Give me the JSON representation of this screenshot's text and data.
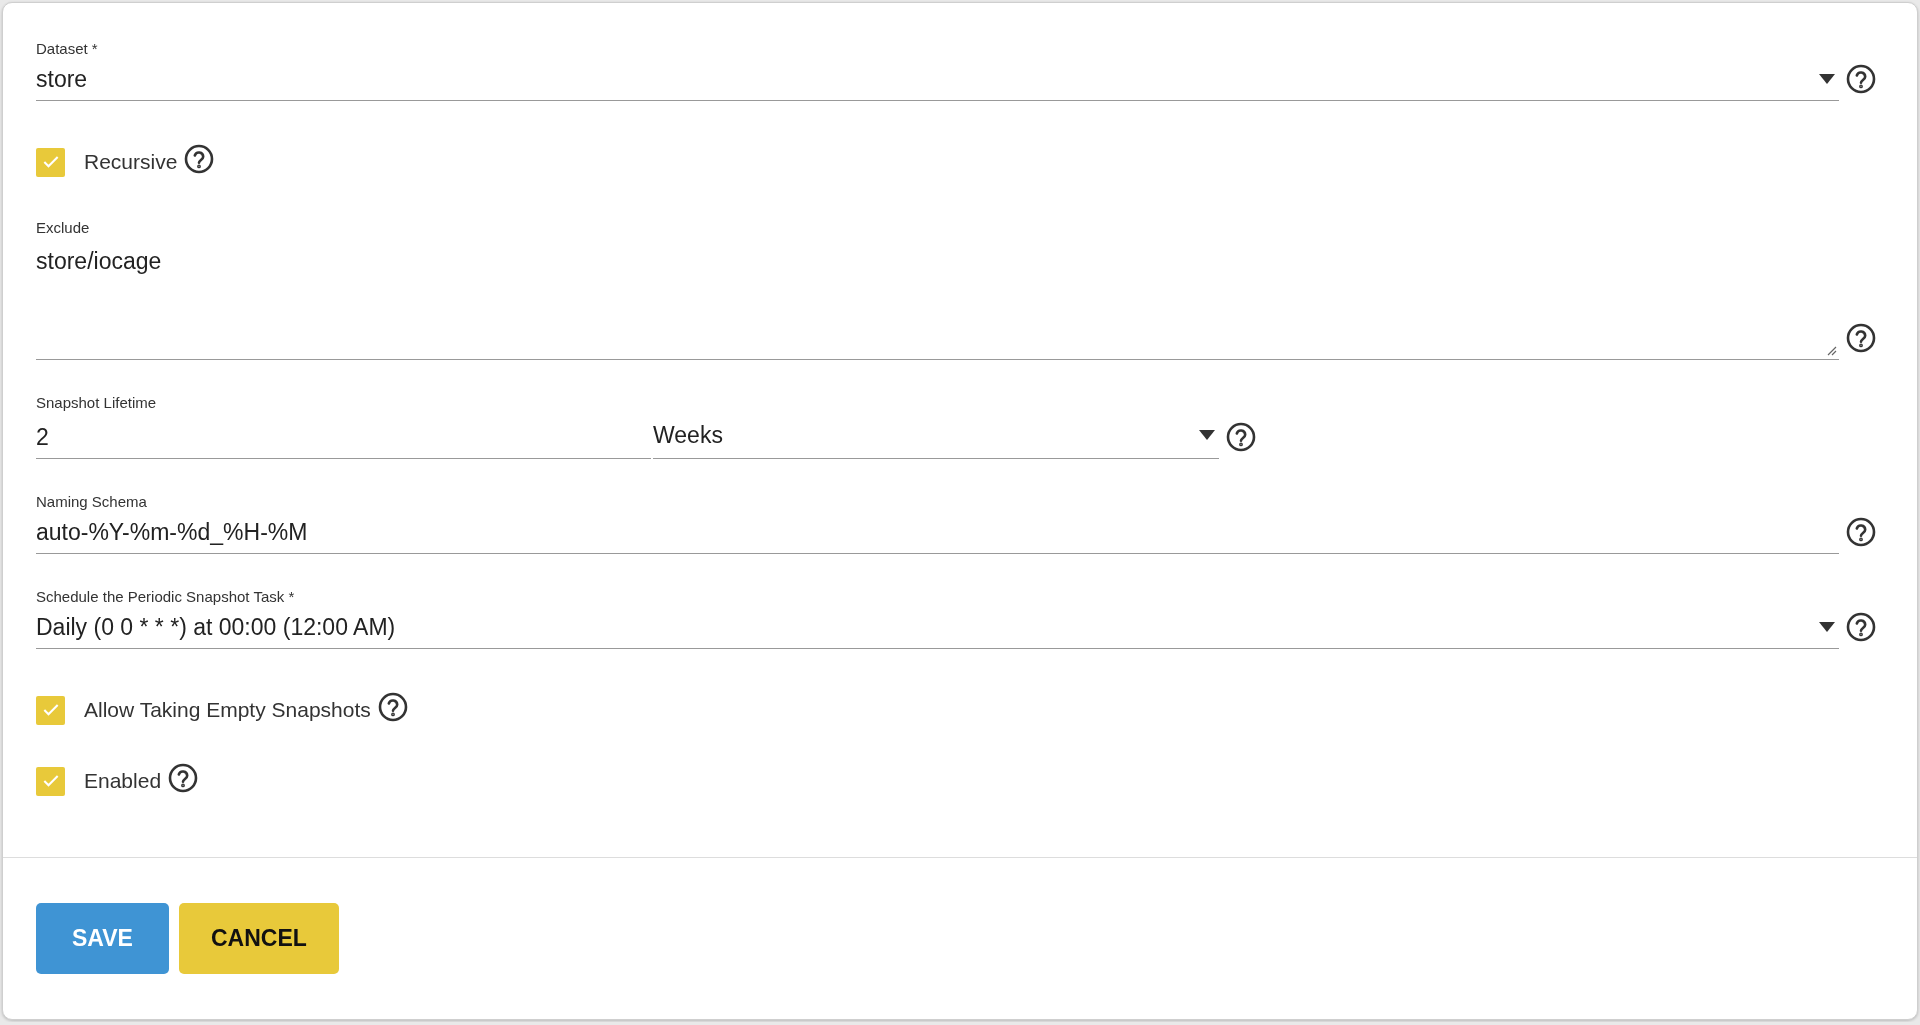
{
  "fields": [
    {
      "kind": "select",
      "label": "Dataset *",
      "value": "store"
    },
    {
      "kind": "checkbox",
      "label": "Recursive",
      "checked": true
    },
    {
      "kind": "textarea",
      "label": "Exclude",
      "value": "store/iocage"
    },
    {
      "kind": "lifetime",
      "label": "Snapshot Lifetime",
      "value": "2",
      "unit": "Weeks"
    },
    {
      "kind": "text",
      "label": "Naming Schema",
      "value": "auto-%Y-%m-%d_%H-%M"
    },
    {
      "kind": "select",
      "label": "Schedule the Periodic Snapshot Task *",
      "value": "Daily (0 0 * * *) at 00:00 (12:00 AM)"
    },
    {
      "kind": "checkbox",
      "label": "Allow Taking Empty Snapshots",
      "checked": true
    },
    {
      "kind": "checkbox",
      "label": "Enabled",
      "checked": true
    }
  ],
  "buttons": [
    {
      "label": "SAVE",
      "kind": "primary"
    },
    {
      "label": "CANCEL",
      "kind": "secondary"
    }
  ]
}
